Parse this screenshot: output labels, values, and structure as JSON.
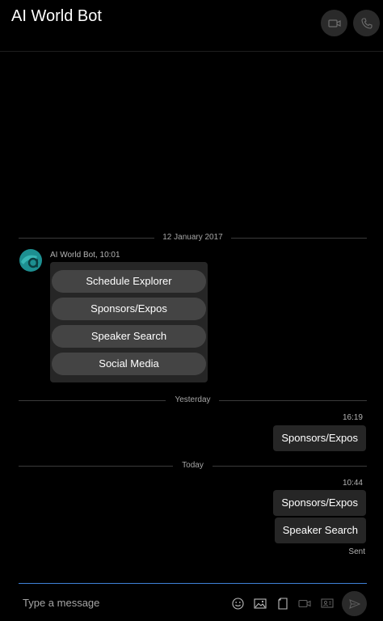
{
  "header": {
    "title": "AI World Bot"
  },
  "timeline": {
    "divider_1": "12 January 2017",
    "divider_2": "Yesterday",
    "divider_3": "Today"
  },
  "bot_message": {
    "sender": "AI World Bot, 10:01",
    "buttons": [
      "Schedule Explorer",
      "Sponsors/Expos",
      "Speaker Search",
      "Social Media"
    ]
  },
  "outgoing_yesterday": {
    "time": "16:19",
    "text": "Sponsors/Expos"
  },
  "outgoing_today": {
    "time": "10:44",
    "messages": [
      "Sponsors/Expos",
      "Speaker Search"
    ],
    "status": "Sent"
  },
  "composer": {
    "placeholder": "Type a message"
  }
}
